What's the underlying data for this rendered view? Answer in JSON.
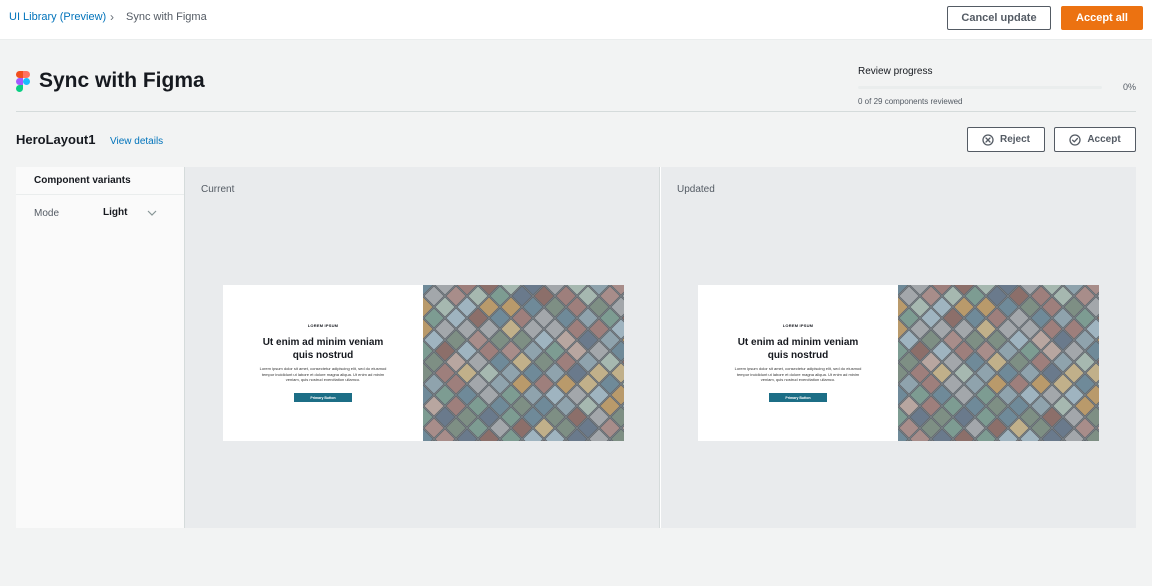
{
  "breadcrumb": {
    "parent": "UI Library (Preview)",
    "separator": "›",
    "current": "Sync with Figma"
  },
  "header_actions": {
    "cancel_label": "Cancel update",
    "accept_all_label": "Accept all"
  },
  "page": {
    "title": "Sync with Figma",
    "logo_icon": "figma-logo-icon"
  },
  "review_progress": {
    "label": "Review progress",
    "percent_text": "0%",
    "percent_value": 0,
    "count_text": "0 of 29 components reviewed"
  },
  "component": {
    "name": "HeroLayout1",
    "view_details_label": "View details",
    "reject_label": "Reject",
    "accept_label": "Accept",
    "reject_icon": "close-circle-icon",
    "accept_icon": "check-circle-icon"
  },
  "variants": {
    "title": "Component variants",
    "mode_label": "Mode",
    "mode_value": "Light",
    "mode_icon": "chevron-down-icon"
  },
  "comparison": {
    "current_label": "Current",
    "updated_label": "Updated"
  },
  "hero_preview": {
    "eyebrow": "LOREM IPSUM",
    "heading": "Ut enim ad minim veniam quis nostrud",
    "body": "Lorem ipsum dolor sit amet, consectetur adipiscing elit, sed do eiusmod tempor incididunt ut labore et dolore magna aliqua. Ut enim ad minim veniam, quis nostrud exercitation ullamco.",
    "button_label": "Primary Button",
    "image_icon": "tile-mosaic-image"
  },
  "colors": {
    "accent": "#ec7211",
    "link": "#0073bb",
    "hero_button": "#1c6e86"
  }
}
